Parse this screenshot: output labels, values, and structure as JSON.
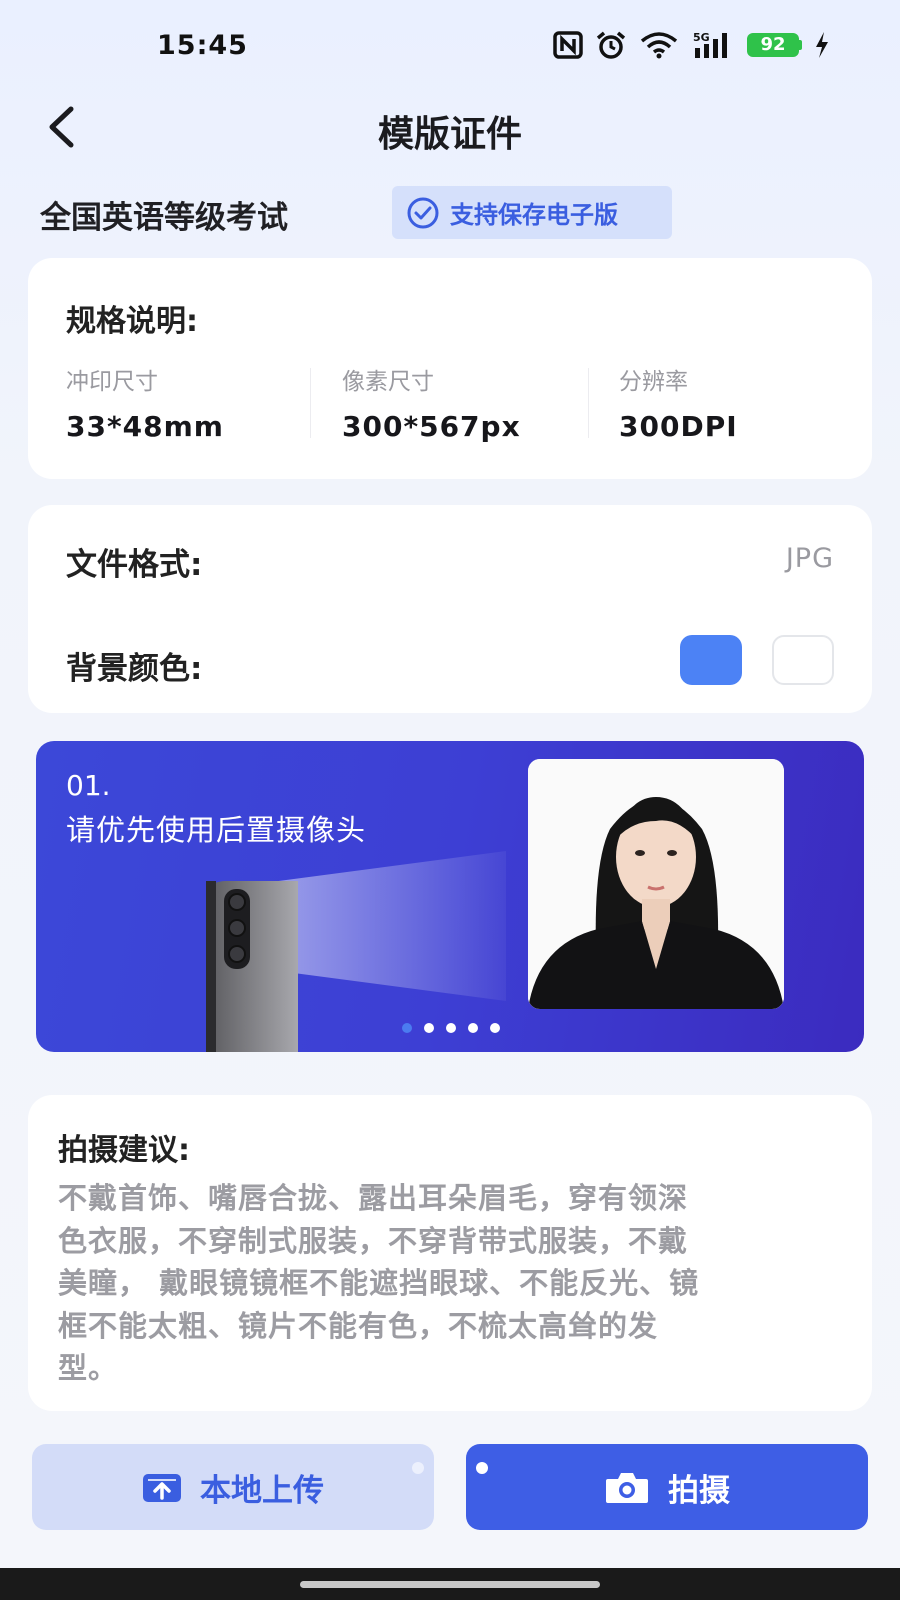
{
  "status_bar": {
    "time": "15:45",
    "battery": "92",
    "network": "5G",
    "battery_color": "#2fc24a"
  },
  "header": {
    "title": "模版证件",
    "back_icon": "chevron-left-icon"
  },
  "exam": {
    "name": "全国英语等级考试",
    "badge_label": "支持保存电子版",
    "badge_icon": "check-circle-icon"
  },
  "spec": {
    "title": "规格说明:",
    "items": [
      {
        "label": "冲印尺寸",
        "value": "33*48mm"
      },
      {
        "label": "像素尺寸",
        "value": "300*567px"
      },
      {
        "label": "分辨率",
        "value": "300DPI"
      }
    ]
  },
  "format": {
    "file_format_label": "文件格式:",
    "file_format_value": "JPG",
    "background_label": "背景颜色:",
    "background_colors": [
      "#4c82f5",
      "#ffffff"
    ],
    "selected_color": "#4c82f5"
  },
  "banner": {
    "step": "01.",
    "tip": "请优先使用后置摄像头",
    "slides_total": 5,
    "active_slide": 1
  },
  "advice": {
    "title": "拍摄建议:",
    "lines": [
      "不戴首饰、嘴唇合拢、露出耳朵眉毛，穿有领深",
      "色衣服，不穿制式服装，不穿背带式服装，不戴",
      "美瞳， 戴眼镜镜框不能遮挡眼球、不能反光、镜",
      "框不能太粗、镜片不能有色，不梳太高耸的发",
      "型。"
    ]
  },
  "actions": {
    "upload_label": "本地上传",
    "upload_icon": "cloud-upload-icon",
    "shoot_label": "拍摄",
    "shoot_icon": "camera-icon"
  },
  "colors": {
    "accent": "#3e5ee5",
    "accent_light": "#d3dcf8",
    "banner_start": "#3c48d8",
    "banner_end": "#3b2bbf"
  }
}
